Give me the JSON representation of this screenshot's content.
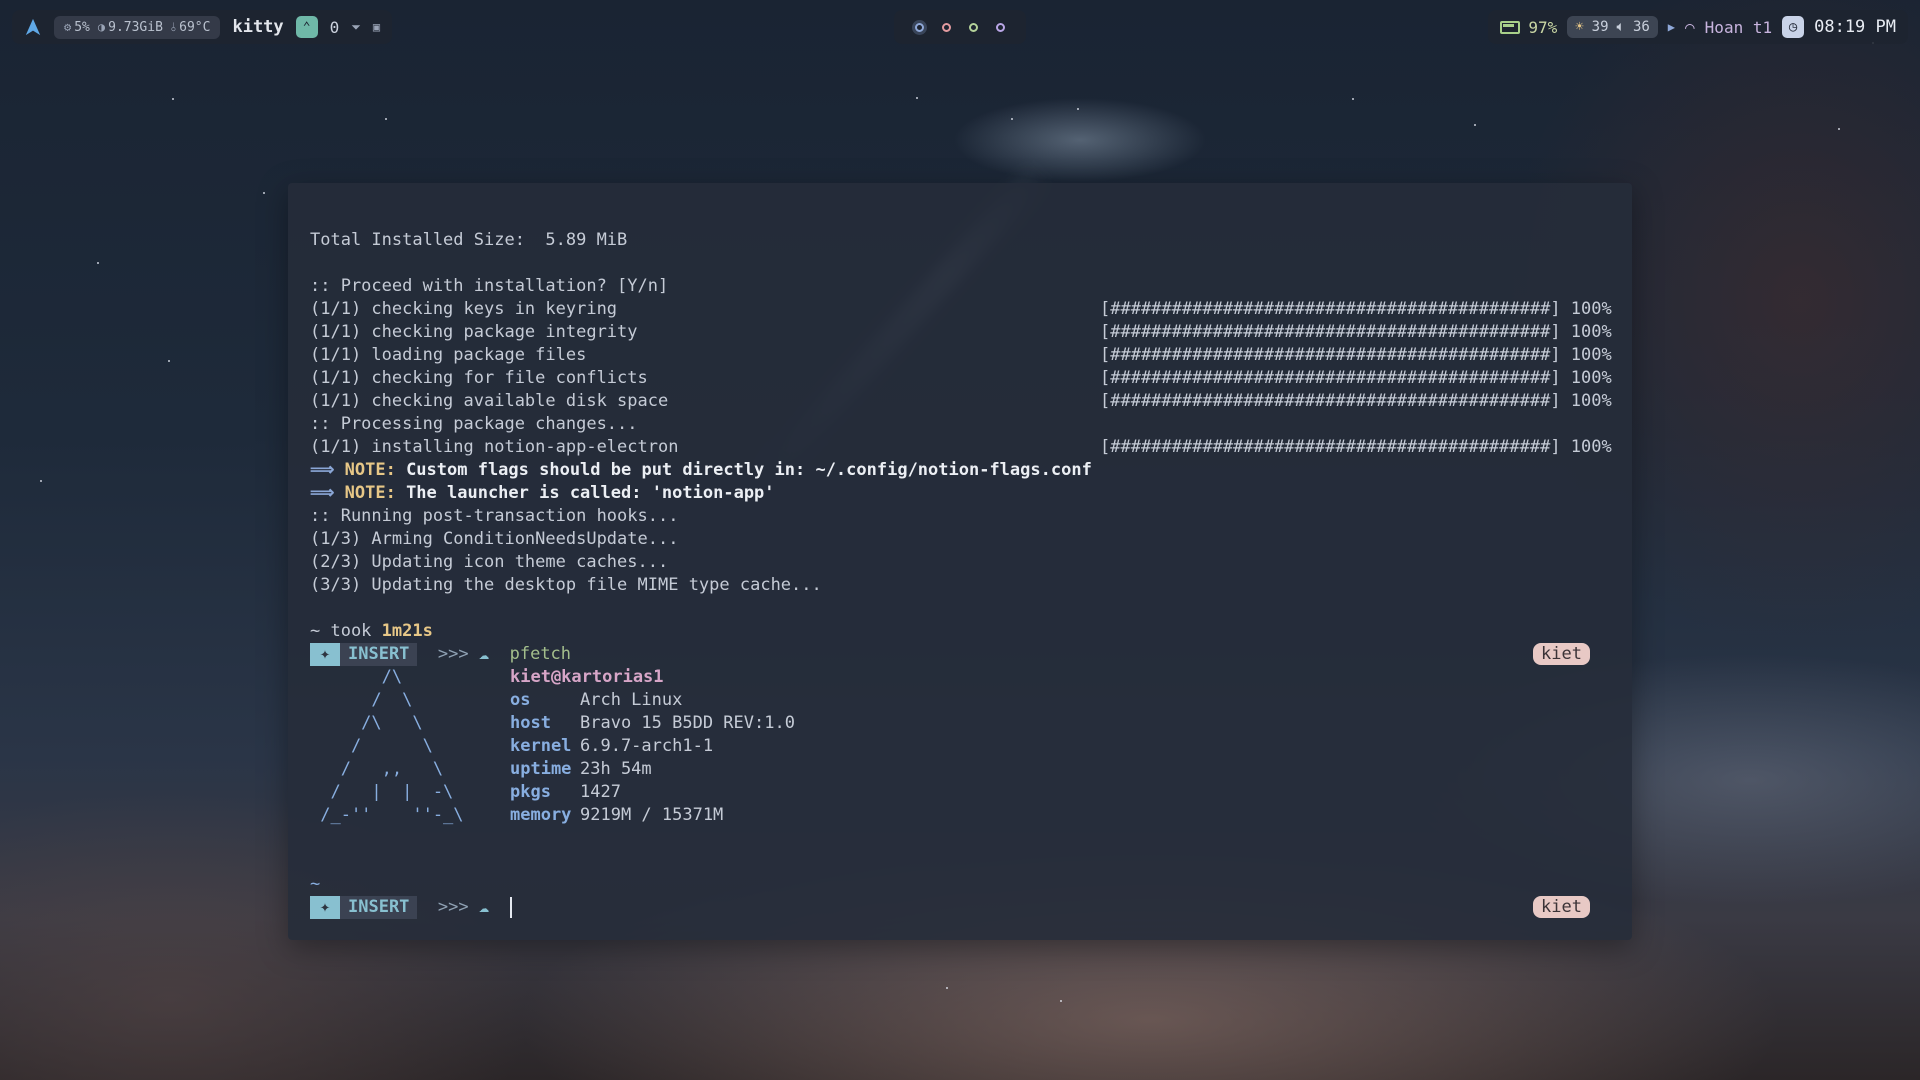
{
  "topbar": {
    "app_name": "kitty",
    "cpu": "5%",
    "memory": "9.73GiB",
    "temperature": "69°C",
    "notification_count": "0",
    "battery": "97%",
    "brightness": "39",
    "volume": "36",
    "wifi_name": "Hoan t1",
    "time": "08:19 PM",
    "colors": {
      "accent": "#8fa8d8",
      "battery": "#a8d08a",
      "app_badge": "#6fb8a8"
    }
  },
  "terminal": {
    "install_size": "Total Installed Size:  5.89 MiB",
    "proceed": ":: Proceed with installation? [Y/n]",
    "steps": [
      "(1/1) checking keys in keyring",
      "(1/1) checking package integrity",
      "(1/1) loading package files",
      "(1/1) checking for file conflicts",
      "(1/1) checking available disk space",
      ":: Processing package changes...",
      "(1/1) installing notion-app-electron"
    ],
    "progress_bar": "[###########################################] 100%",
    "note_arrow": "⟹",
    "note_label": "NOTE:",
    "note1": "Custom flags should be put directly in: ~/.config/notion-flags.conf",
    "note2": "The launcher is called: 'notion-app'",
    "hooks": [
      ":: Running post-transaction hooks...",
      "(1/3) Arming ConditionNeedsUpdate...",
      "(2/3) Updating icon theme caches...",
      "(3/3) Updating the desktop file MIME type cache..."
    ],
    "took_label": "~ took",
    "took_value": "1m21s",
    "mode": "INSERT",
    "prompt_arrows": ">>>",
    "command": "pfetch",
    "user_badge": "kiet",
    "tilde": "~",
    "ascii_art": [
      "       /\\",
      "      /  \\",
      "     /\\   \\",
      "    /      \\",
      "   /   ,,   \\",
      "  /   |  |  -\\",
      " /_-''    ''-_\\"
    ],
    "pfetch": {
      "title": "kiet@kartorias1",
      "rows": [
        {
          "key": "os",
          "value": "Arch Linux"
        },
        {
          "key": "host",
          "value": "Bravo 15 B5DD REV:1.0"
        },
        {
          "key": "kernel",
          "value": "6.9.7-arch1-1"
        },
        {
          "key": "uptime",
          "value": "23h 54m"
        },
        {
          "key": "pkgs",
          "value": "1427"
        },
        {
          "key": "memory",
          "value": "9219M / 15371M"
        }
      ]
    }
  }
}
